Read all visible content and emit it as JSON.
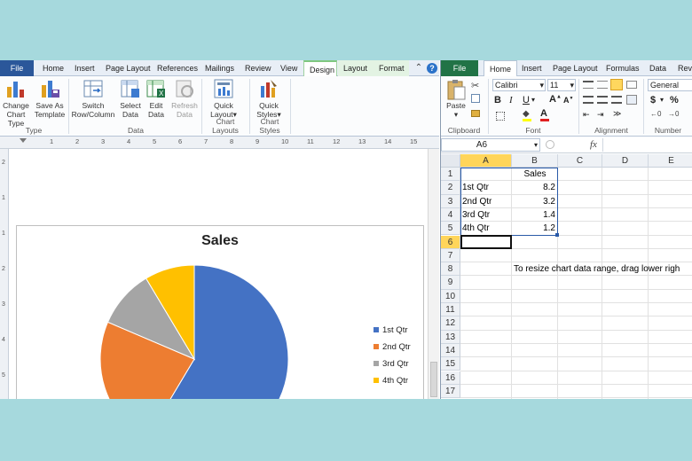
{
  "word": {
    "tabs": [
      "File",
      "Home",
      "Insert",
      "Page Layout",
      "References",
      "Mailings",
      "Review",
      "View",
      "Design",
      "Layout",
      "Format"
    ],
    "ribbon": {
      "change_chart_type": [
        "Change",
        "Chart Type"
      ],
      "save_as_template": [
        "Save As",
        "Template"
      ],
      "switch_row_column": [
        "Switch",
        "Row/Column"
      ],
      "select_data": [
        "Select",
        "Data"
      ],
      "edit_data": [
        "Edit",
        "Data"
      ],
      "refresh_data": [
        "Refresh",
        "Data"
      ],
      "quick_layout": [
        "Quick",
        "Layout"
      ],
      "quick_styles": [
        "Quick",
        "Styles"
      ],
      "groups": [
        "Type",
        "Data",
        "Chart Layouts",
        "Chart Styles"
      ]
    },
    "ruler_numbers": [
      "1",
      "2",
      "3",
      "4",
      "5",
      "6",
      "7",
      "8",
      "9",
      "10",
      "11",
      "12",
      "13",
      "14",
      "15"
    ],
    "vruler_numbers": [
      "2",
      "1",
      "1",
      "2",
      "3",
      "4",
      "5"
    ]
  },
  "chart_data": {
    "type": "pie",
    "title": "Sales",
    "categories": [
      "1st Qtr",
      "2nd Qtr",
      "3rd Qtr",
      "4th Qtr"
    ],
    "values": [
      8.2,
      3.2,
      1.4,
      1.2
    ],
    "colors": [
      "#4472c4",
      "#ed7d31",
      "#a5a5a5",
      "#ffc000"
    ],
    "legend_position": "right"
  },
  "excel": {
    "tabs": [
      "File",
      "Home",
      "Insert",
      "Page Layout",
      "Formulas",
      "Data",
      "Revi"
    ],
    "font_name": "Calibri",
    "font_size": "11",
    "number_format": "General",
    "groups": [
      "Clipboard",
      "Font",
      "Alignment",
      "Number"
    ],
    "paste_label": "Paste",
    "name_box": "A6",
    "fx": "fx",
    "col_headers": [
      "A",
      "B",
      "C",
      "D",
      "E"
    ],
    "row_numbers": [
      "1",
      "2",
      "3",
      "4",
      "5",
      "6",
      "7",
      "8",
      "9",
      "10",
      "11",
      "12",
      "13",
      "14",
      "15",
      "16",
      "17"
    ],
    "cells": {
      "B1": "Sales",
      "A2": "1st Qtr",
      "B2": "8.2",
      "A3": "2nd Qtr",
      "B3": "3.2",
      "A4": "3rd Qtr",
      "B4": "1.4",
      "A5": "4th Qtr",
      "B5": "1.2",
      "B8": "To resize chart data range, drag lower righ"
    }
  }
}
